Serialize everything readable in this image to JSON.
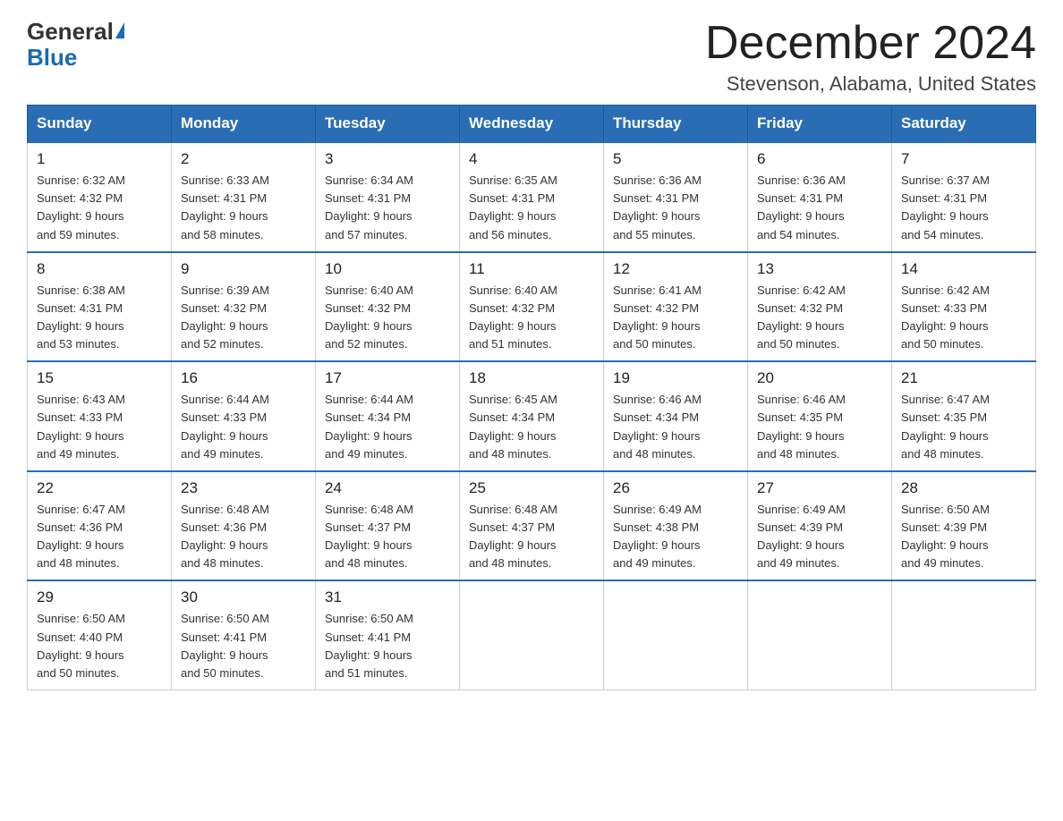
{
  "header": {
    "logo": {
      "general": "General",
      "blue": "Blue",
      "triangle": "▲"
    },
    "title": "December 2024",
    "location": "Stevenson, Alabama, United States"
  },
  "days_of_week": [
    "Sunday",
    "Monday",
    "Tuesday",
    "Wednesday",
    "Thursday",
    "Friday",
    "Saturday"
  ],
  "weeks": [
    [
      {
        "day": "1",
        "sunrise": "6:32 AM",
        "sunset": "4:32 PM",
        "daylight": "9 hours and 59 minutes."
      },
      {
        "day": "2",
        "sunrise": "6:33 AM",
        "sunset": "4:31 PM",
        "daylight": "9 hours and 58 minutes."
      },
      {
        "day": "3",
        "sunrise": "6:34 AM",
        "sunset": "4:31 PM",
        "daylight": "9 hours and 57 minutes."
      },
      {
        "day": "4",
        "sunrise": "6:35 AM",
        "sunset": "4:31 PM",
        "daylight": "9 hours and 56 minutes."
      },
      {
        "day": "5",
        "sunrise": "6:36 AM",
        "sunset": "4:31 PM",
        "daylight": "9 hours and 55 minutes."
      },
      {
        "day": "6",
        "sunrise": "6:36 AM",
        "sunset": "4:31 PM",
        "daylight": "9 hours and 54 minutes."
      },
      {
        "day": "7",
        "sunrise": "6:37 AM",
        "sunset": "4:31 PM",
        "daylight": "9 hours and 54 minutes."
      }
    ],
    [
      {
        "day": "8",
        "sunrise": "6:38 AM",
        "sunset": "4:31 PM",
        "daylight": "9 hours and 53 minutes."
      },
      {
        "day": "9",
        "sunrise": "6:39 AM",
        "sunset": "4:32 PM",
        "daylight": "9 hours and 52 minutes."
      },
      {
        "day": "10",
        "sunrise": "6:40 AM",
        "sunset": "4:32 PM",
        "daylight": "9 hours and 52 minutes."
      },
      {
        "day": "11",
        "sunrise": "6:40 AM",
        "sunset": "4:32 PM",
        "daylight": "9 hours and 51 minutes."
      },
      {
        "day": "12",
        "sunrise": "6:41 AM",
        "sunset": "4:32 PM",
        "daylight": "9 hours and 50 minutes."
      },
      {
        "day": "13",
        "sunrise": "6:42 AM",
        "sunset": "4:32 PM",
        "daylight": "9 hours and 50 minutes."
      },
      {
        "day": "14",
        "sunrise": "6:42 AM",
        "sunset": "4:33 PM",
        "daylight": "9 hours and 50 minutes."
      }
    ],
    [
      {
        "day": "15",
        "sunrise": "6:43 AM",
        "sunset": "4:33 PM",
        "daylight": "9 hours and 49 minutes."
      },
      {
        "day": "16",
        "sunrise": "6:44 AM",
        "sunset": "4:33 PM",
        "daylight": "9 hours and 49 minutes."
      },
      {
        "day": "17",
        "sunrise": "6:44 AM",
        "sunset": "4:34 PM",
        "daylight": "9 hours and 49 minutes."
      },
      {
        "day": "18",
        "sunrise": "6:45 AM",
        "sunset": "4:34 PM",
        "daylight": "9 hours and 48 minutes."
      },
      {
        "day": "19",
        "sunrise": "6:46 AM",
        "sunset": "4:34 PM",
        "daylight": "9 hours and 48 minutes."
      },
      {
        "day": "20",
        "sunrise": "6:46 AM",
        "sunset": "4:35 PM",
        "daylight": "9 hours and 48 minutes."
      },
      {
        "day": "21",
        "sunrise": "6:47 AM",
        "sunset": "4:35 PM",
        "daylight": "9 hours and 48 minutes."
      }
    ],
    [
      {
        "day": "22",
        "sunrise": "6:47 AM",
        "sunset": "4:36 PM",
        "daylight": "9 hours and 48 minutes."
      },
      {
        "day": "23",
        "sunrise": "6:48 AM",
        "sunset": "4:36 PM",
        "daylight": "9 hours and 48 minutes."
      },
      {
        "day": "24",
        "sunrise": "6:48 AM",
        "sunset": "4:37 PM",
        "daylight": "9 hours and 48 minutes."
      },
      {
        "day": "25",
        "sunrise": "6:48 AM",
        "sunset": "4:37 PM",
        "daylight": "9 hours and 48 minutes."
      },
      {
        "day": "26",
        "sunrise": "6:49 AM",
        "sunset": "4:38 PM",
        "daylight": "9 hours and 49 minutes."
      },
      {
        "day": "27",
        "sunrise": "6:49 AM",
        "sunset": "4:39 PM",
        "daylight": "9 hours and 49 minutes."
      },
      {
        "day": "28",
        "sunrise": "6:50 AM",
        "sunset": "4:39 PM",
        "daylight": "9 hours and 49 minutes."
      }
    ],
    [
      {
        "day": "29",
        "sunrise": "6:50 AM",
        "sunset": "4:40 PM",
        "daylight": "9 hours and 50 minutes."
      },
      {
        "day": "30",
        "sunrise": "6:50 AM",
        "sunset": "4:41 PM",
        "daylight": "9 hours and 50 minutes."
      },
      {
        "day": "31",
        "sunrise": "6:50 AM",
        "sunset": "4:41 PM",
        "daylight": "9 hours and 51 minutes."
      },
      null,
      null,
      null,
      null
    ]
  ],
  "labels": {
    "sunrise": "Sunrise:",
    "sunset": "Sunset:",
    "daylight": "Daylight:"
  }
}
